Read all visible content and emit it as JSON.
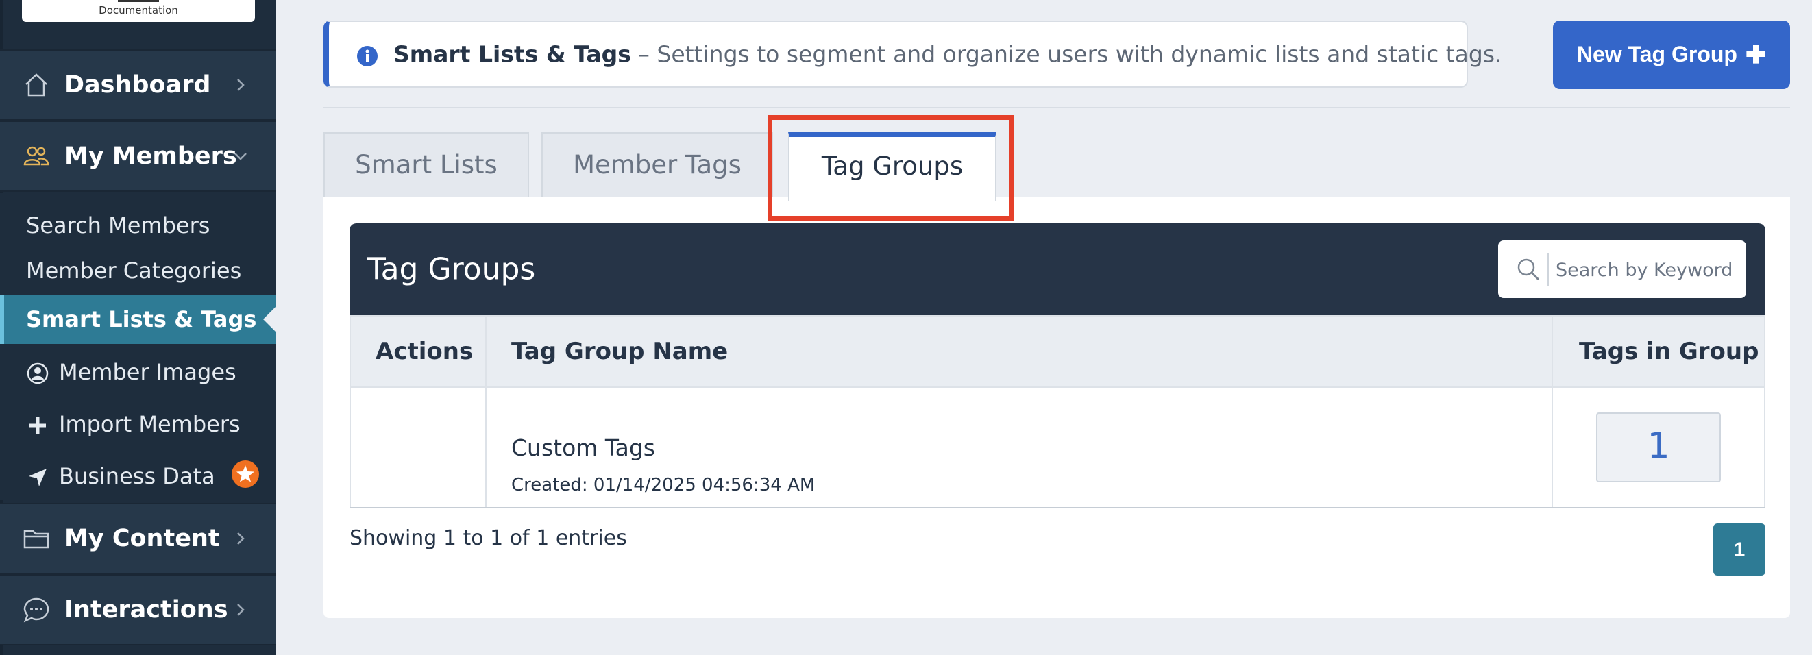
{
  "sidebar": {
    "logo_text": "Documentation",
    "nav": {
      "dashboard": "Dashboard",
      "my_members": "My Members",
      "my_content": "My Content",
      "interactions": "Interactions"
    },
    "members_submenu": {
      "search": "Search Members",
      "categories": "Member Categories",
      "smart_lists": "Smart Lists & Tags",
      "images": "Member Images",
      "import": "Import Members",
      "business": "Business Data"
    }
  },
  "header": {
    "banner_title": "Smart Lists & Tags",
    "banner_text": " – Settings to segment and organize users with dynamic lists and static tags.",
    "new_button": "New Tag Group",
    "new_button_icon": "plus-icon"
  },
  "tabs": {
    "smart_lists": "Smart Lists",
    "member_tags": "Member Tags",
    "tag_groups": "Tag Groups",
    "active": "Tag Groups"
  },
  "table": {
    "title": "Tag Groups",
    "search_placeholder": "Search by Keyword",
    "columns": {
      "actions": "Actions",
      "name": "Tag Group Name",
      "count": "Tags in Group"
    },
    "rows": [
      {
        "name": "Custom Tags",
        "created": "Created: 01/14/2025 04:56:34 AM",
        "count": "1"
      }
    ],
    "entries_info": "Showing 1 to 1 of 1 entries",
    "current_page": "1"
  },
  "colors": {
    "accent": "#3466c9",
    "sidebar_bg": "#1e2d3d",
    "active_item": "#2e7b95",
    "highlight": "#e5402a"
  }
}
